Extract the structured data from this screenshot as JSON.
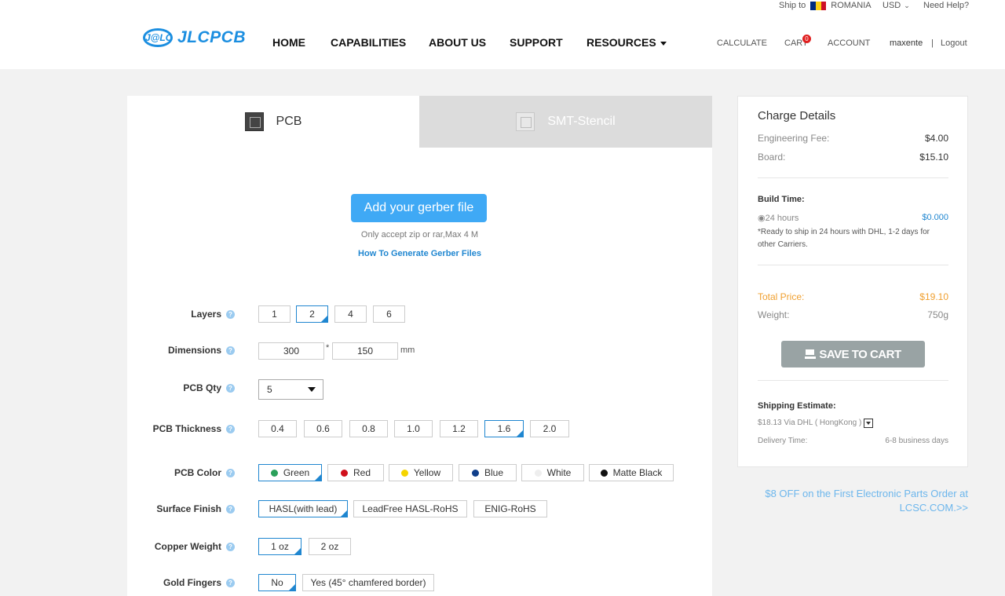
{
  "header": {
    "ship_to": "Ship to",
    "country": "ROMANIA",
    "currency": "USD",
    "help": "Need Help?",
    "logo_mark": "J@LC",
    "logo_text": "JLCPCB",
    "nav": [
      "HOME",
      "CAPABILITIES",
      "ABOUT US",
      "SUPPORT",
      "RESOURCES"
    ],
    "calculate": "CALCULATE",
    "cart": "CART",
    "cart_count": "0",
    "account": "ACCOUNT",
    "username": "maxente",
    "separator": "|",
    "logout": "Logout",
    "flag_colors": [
      "#002b7f",
      "#fcd116",
      "#ce1126"
    ]
  },
  "tabs": {
    "pcb": "PCB",
    "stencil": "SMT-Stencil"
  },
  "upload": {
    "button": "Add your gerber file",
    "hint": "Only accept zip or rar,Max 4 M",
    "howto": "How To Generate Gerber Files"
  },
  "form": {
    "layers": {
      "label": "Layers",
      "options": [
        "1",
        "2",
        "4",
        "6"
      ],
      "selected": "2"
    },
    "dimensions": {
      "label": "Dimensions",
      "width": "300",
      "times": "*",
      "height": "150",
      "unit": "mm"
    },
    "qty": {
      "label": "PCB Qty",
      "value": "5"
    },
    "thickness": {
      "label": "PCB Thickness",
      "options": [
        "0.4",
        "0.6",
        "0.8",
        "1.0",
        "1.2",
        "1.6",
        "2.0"
      ],
      "selected": "1.6"
    },
    "color": {
      "label": "PCB Color",
      "options": [
        {
          "name": "Green",
          "dot": "#2aa05a"
        },
        {
          "name": "Red",
          "dot": "#d0101c"
        },
        {
          "name": "Yellow",
          "dot": "#f5d400"
        },
        {
          "name": "Blue",
          "dot": "#0f3e8a"
        },
        {
          "name": "White",
          "dot": "#eeeeee"
        },
        {
          "name": "Matte Black",
          "dot": "#111111"
        }
      ],
      "selected": "Green"
    },
    "surface": {
      "label": "Surface Finish",
      "options": [
        "HASL(with lead)",
        "LeadFree HASL-RoHS",
        "ENIG-RoHS"
      ],
      "selected": "HASL(with lead)"
    },
    "copper": {
      "label": "Copper Weight",
      "options": [
        "1 oz",
        "2 oz"
      ],
      "selected": "1 oz"
    },
    "gold": {
      "label": "Gold Fingers",
      "options": [
        "No",
        "Yes (45° chamfered border)"
      ],
      "selected": "No"
    },
    "help_icon": "?"
  },
  "charges": {
    "title": "Charge Details",
    "engineering_label": "Engineering Fee:",
    "engineering_value": "$4.00",
    "board_label": "Board:",
    "board_value": "$15.10",
    "build_time": "Build Time:",
    "build_option": "24 hours",
    "build_price": "$0.000",
    "build_note": "*Ready to ship in 24 hours with DHL, 1-2 days for other Carriers.",
    "total_label": "Total Price:",
    "total_value": "$19.10",
    "weight_label": "Weight:",
    "weight_value": "750g",
    "save_button": "SAVE TO CART",
    "shipping_label": "Shipping Estimate:",
    "shipping_value": "$18.13 Via  DHL ( HongKong )",
    "delivery_label": "Delivery Time:",
    "delivery_value": "6-8 business days",
    "accent_orange": "#f0a030",
    "accent_blue": "#1f86d0"
  },
  "promo": {
    "line1": "$8 OFF on the First Electronic Parts Order at",
    "line2": "LCSC.COM.>>"
  }
}
